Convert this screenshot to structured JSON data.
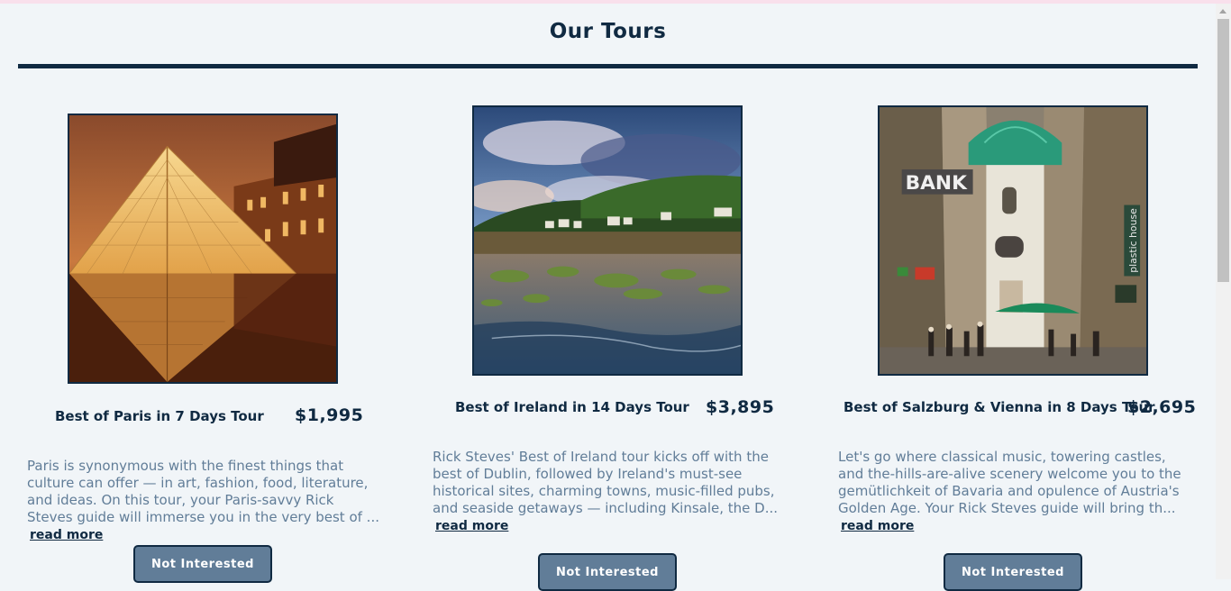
{
  "page": {
    "title": "Our Tours"
  },
  "colors": {
    "primary": "#102a42",
    "muted": "#617d98",
    "button": "#617d98",
    "background": "#f1f5f8"
  },
  "tours": [
    {
      "name": "Best of Paris in 7 Days Tour",
      "price": "$1,995",
      "description": "Paris is synonymous with the finest things that culture can offer — in art, fashion, food, literature, and ideas. On this tour, your Paris-savvy Rick Steves guide will immerse you in the very best of ...",
      "read_more": "read more",
      "button": "Not Interested",
      "image": "louvre-pyramid-photo"
    },
    {
      "name": "Best of Ireland in 14 Days Tour",
      "price": "$3,895",
      "description": "Rick Steves' Best of Ireland tour kicks off with the best of Dublin, followed by Ireland's must-see historical sites, charming towns, music-filled pubs, and seaside getaways — including Kinsale, the D...",
      "read_more": "read more",
      "button": "Not Interested",
      "image": "irish-coast-photo"
    },
    {
      "name": "Best of Salzburg & Vienna in 8 Days Tour",
      "price": "$2,695",
      "description": "Let's go where classical music, towering castles, and the-hills-are-alive scenery welcome you to the gemütlichkeit of Bavaria and opulence of Austria's Golden Age. Your Rick Steves guide will bring th...",
      "read_more": "read more",
      "button": "Not Interested",
      "image": "vienna-street-photo",
      "image_text": {
        "sign": "BANK",
        "banner": "plastic house"
      }
    }
  ]
}
